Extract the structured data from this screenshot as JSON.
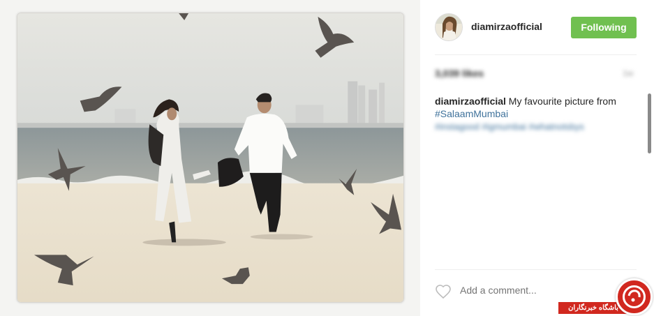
{
  "post": {
    "username": "diamirzaofficial",
    "follow_label": "Following",
    "likes_text": "3,039 likes",
    "time_text": "1w",
    "caption_user": "diamirzaofficial",
    "caption_text": " My favourite picture from ",
    "caption_tag": "#SalaamMumbai",
    "blurred_tags": "#instagood #igmumbai #whatnotsbys",
    "comment_placeholder": "Add a comment..."
  },
  "watermark": {
    "text": "باشگاه خبرنگاران"
  },
  "colors": {
    "follow_green": "#70c050",
    "hashtag_blue": "#3f729b",
    "watermark_red": "#d1281f"
  },
  "icons": {
    "like": "heart-outline-icon",
    "watermark": "club-logo-icon"
  }
}
